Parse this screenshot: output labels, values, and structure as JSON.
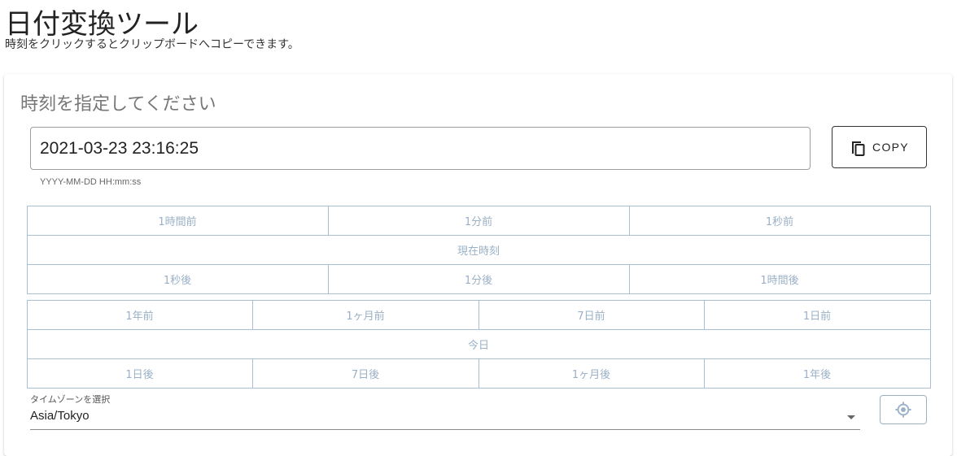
{
  "header": {
    "title": "日付変換ツール",
    "subtitle": "時刻をクリックするとクリップボードへコピーできます。"
  },
  "card": {
    "title": "時刻を指定してください",
    "datetime_value": "2021-03-23 23:16:25",
    "datetime_hint": "YYYY-MM-DD HH:mm:ss",
    "copy_label": "COPY",
    "copy_icon": "copy-icon"
  },
  "time_buttons": {
    "row1": [
      "1時間前",
      "1分前",
      "1秒前"
    ],
    "now": "現在時刻",
    "row3": [
      "1秒後",
      "1分後",
      "1時間後"
    ]
  },
  "date_buttons": {
    "row1": [
      "1年前",
      "1ヶ月前",
      "7日前",
      "1日前"
    ],
    "today": "今日",
    "row3": [
      "1日後",
      "7日後",
      "1ヶ月後",
      "1年後"
    ]
  },
  "timezone": {
    "label": "タイムゾーンを選択",
    "selected": "Asia/Tokyo",
    "locate_icon": "gps-locate-icon"
  },
  "colors": {
    "button_border": "#a9bfd4",
    "button_text": "#9ab0c6"
  }
}
